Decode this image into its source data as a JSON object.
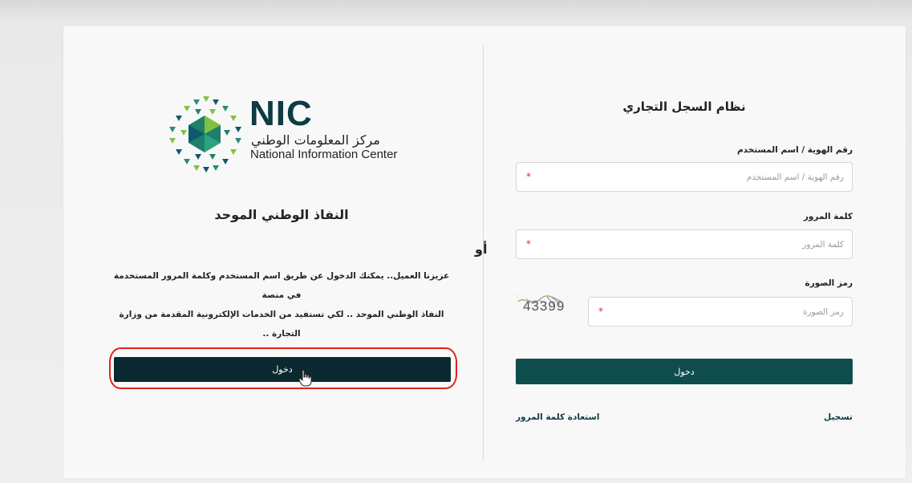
{
  "left": {
    "logo": {
      "abbr": "NIC",
      "arabic_name": "مركز المعلومات الوطني",
      "english_name": "National Information Center"
    },
    "title": "النفاذ الوطني الموحد",
    "description_line1": "عزيزنا العميل.. يمكنك الدخول عن طريق اسم المستخدم وكلمة المرور المستخدمة في منصة",
    "description_line2": "النفاذ الوطني الموحد .. لكي تستفيد من الخدمات الإلكترونية المقدمة من وزارة التجارة ..",
    "login_button": "دخول"
  },
  "or_label": "أو",
  "right": {
    "title": "نظام السجل التجاري",
    "username": {
      "label": "رقم الهوية / اسم المستخدم",
      "placeholder": "رقم الهوية / اسم المستخدم",
      "value": ""
    },
    "password": {
      "label": "كلمة المرور",
      "placeholder": "كلمة المرور",
      "value": ""
    },
    "captcha": {
      "label": "رمز الصورة",
      "placeholder": "رمز الصورة",
      "value": "",
      "image_text": "43399"
    },
    "required_mark": "*",
    "login_button": "دخول",
    "register_link": "تسجيل",
    "forgot_link": "استعادة كلمة المرور"
  },
  "colors": {
    "brand_dark": "#0b2a2f",
    "button_teal": "#0f4d4d",
    "annotation_red": "#e0231b"
  }
}
